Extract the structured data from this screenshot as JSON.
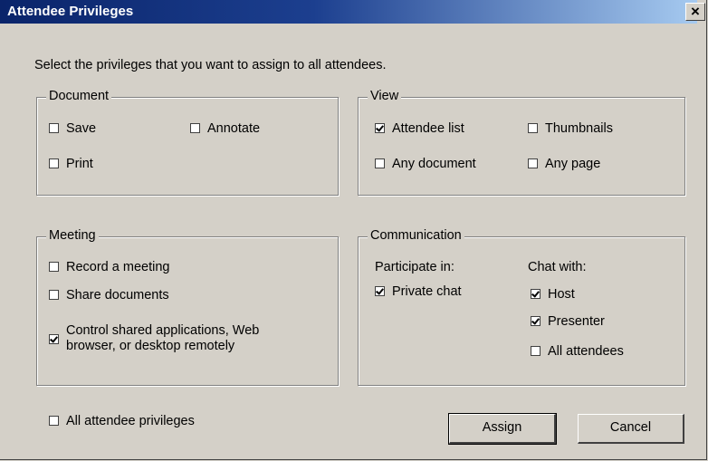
{
  "dialog": {
    "title": "Attendee Privileges",
    "close_label": "×",
    "instruction": "Select the privileges that you want to assign to all attendees."
  },
  "document_group": {
    "legend": "Document",
    "items": [
      {
        "label": "Save",
        "checked": false
      },
      {
        "label": "Annotate",
        "checked": false
      },
      {
        "label": "Print",
        "checked": false
      }
    ]
  },
  "view_group": {
    "legend": "View",
    "items": [
      {
        "label": "Attendee list",
        "checked": true
      },
      {
        "label": "Thumbnails",
        "checked": false
      },
      {
        "label": "Any document",
        "checked": false
      },
      {
        "label": "Any page",
        "checked": false
      }
    ]
  },
  "meeting_group": {
    "legend": "Meeting",
    "items": [
      {
        "label": "Record a meeting",
        "checked": false
      },
      {
        "label": "Share documents",
        "checked": false
      },
      {
        "label": "Control shared applications, Web browser, or desktop remotely",
        "checked": true
      }
    ]
  },
  "communication_group": {
    "legend": "Communication",
    "participate_label": "Participate in:",
    "chat_with_label": "Chat with:",
    "participate_items": [
      {
        "label": "Private chat",
        "checked": true
      }
    ],
    "chat_items": [
      {
        "label": "Host",
        "checked": true
      },
      {
        "label": "Presenter",
        "checked": true
      },
      {
        "label": "All attendees",
        "checked": false
      }
    ]
  },
  "all_privileges": {
    "label": "All attendee privileges",
    "checked": false
  },
  "buttons": {
    "assign": "Assign",
    "cancel": "Cancel"
  }
}
